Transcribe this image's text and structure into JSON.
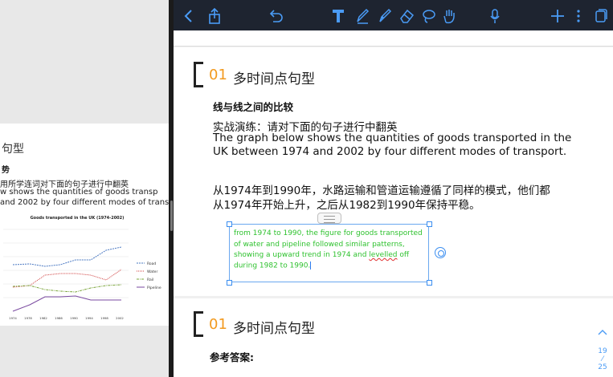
{
  "left": {
    "heading": "句型",
    "subheading": "势",
    "lines": [
      "用所学连词对下面的句子进行中翻英",
      "w shows the quantities of goods transp",
      "and 2002 by four different modes of trans"
    ],
    "chart": {
      "title": "Goods transported in the UK (1974-2002)",
      "x_labels": [
        "1974",
        "1978",
        "1982",
        "1986",
        "1990",
        "1994",
        "1998",
        "2002"
      ],
      "legend": [
        "Road",
        "Water",
        "Rail",
        "Pipeline"
      ]
    }
  },
  "toolbar": {
    "icons": [
      "back-icon",
      "share-icon",
      "undo-icon",
      "text-tool-icon",
      "pen-icon",
      "highlighter-icon",
      "eraser-icon",
      "lasso-icon",
      "hand-icon",
      "microphone-icon",
      "add-icon",
      "more-icon",
      "pages-icon"
    ],
    "accent": "#4a9bf5",
    "background": "#1e2430"
  },
  "section1": {
    "number": "01",
    "title": "多时间点句型",
    "subtitle": "线与线之间的比较",
    "exercise_label": "实战演练：请对下面的句子进行中翻英",
    "exercise_en_line1": "The graph below shows the quantities of goods transported in the",
    "exercise_en_line2": "UK between 1974 and 2002 by four different modes of transport.",
    "cn_line1": "从1974年到1990年，水路运输和管道运输遵循了同样的模式，他们都",
    "cn_line2": "从1974年开始上升，之后从1982到1990年保持平稳。"
  },
  "textbox": {
    "line1": "from 1974 to 1990, the figure for goods transported",
    "line2": "of water and pipeline followed similar patterns,",
    "line3_pre": "showing a upward trend in 1974 and ",
    "line3_err": "levelled",
    "line3_post": " off",
    "line4": "during 1982 to 1990.",
    "color": "#2fc22f"
  },
  "section2": {
    "number": "01",
    "title": "多时间点句型",
    "answer_label": "参考答案:"
  },
  "page_indicator": {
    "current": "19",
    "sep": "⁄",
    "total": "25"
  }
}
